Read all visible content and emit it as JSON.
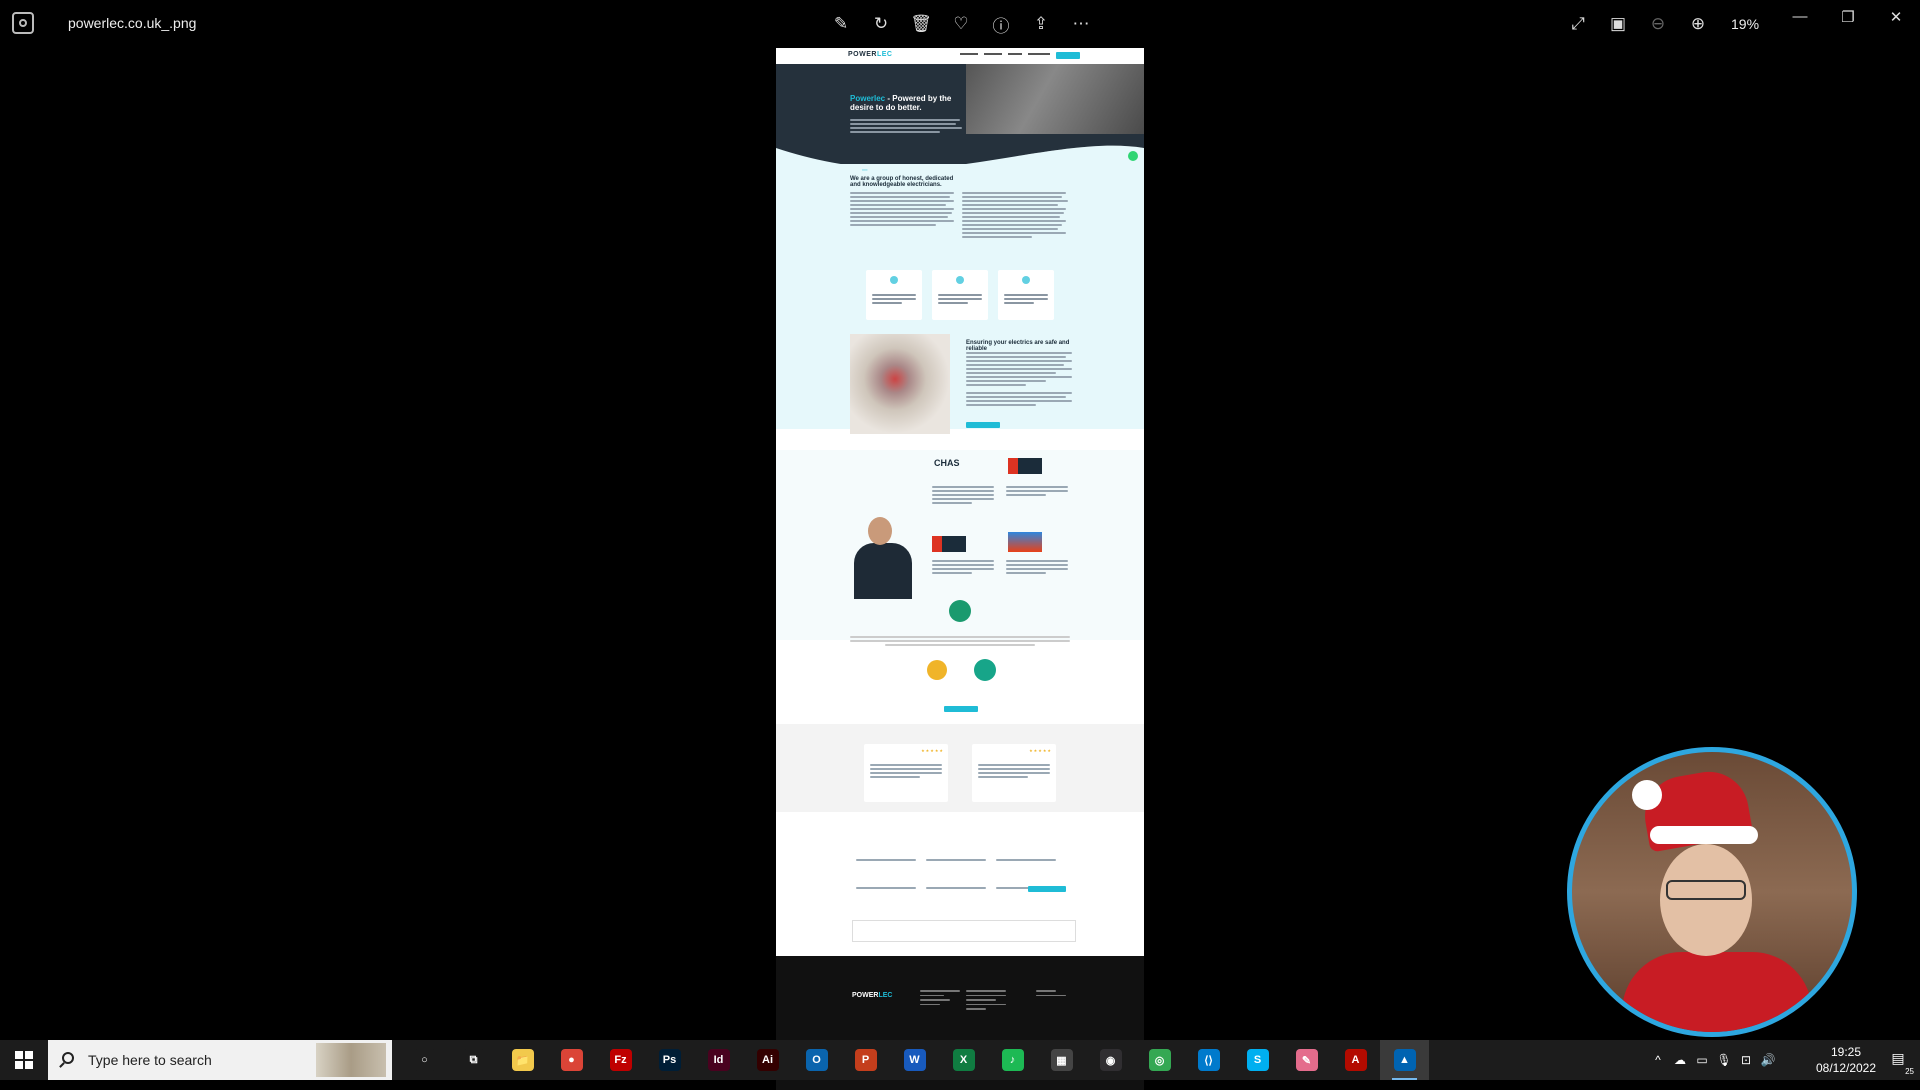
{
  "window": {
    "filename": "powerlec.co.uk_.png",
    "zoom": "19%",
    "toolbar": [
      "edit-icon",
      "rotate-icon",
      "delete-icon",
      "favorite-icon",
      "info-icon",
      "share-icon",
      "more-icon"
    ],
    "right_tools": [
      "fullscreen-icon",
      "actual-size-icon",
      "zoom-out-icon",
      "zoom-in-icon"
    ],
    "controls": {
      "minimize": "—",
      "maximize": "❐",
      "close": "✕"
    }
  },
  "webpage": {
    "logo_main": "POWER",
    "logo_accent": "LEC",
    "hero_title_accent": "Powerlec",
    "hero_title_rest": " - Powered by the desire to do better.",
    "about_title": "We are a group of honest, dedicated and knowledgeable electricians.",
    "services_title": "Ensuring your electrics are safe and reliable",
    "accreditation": {
      "chas": "CHAS"
    },
    "footer_logo_main": "POWER",
    "footer_logo_accent": "LEC"
  },
  "taskbar": {
    "search_placeholder": "Type here to search",
    "time": "19:25",
    "date": "08/12/2022",
    "notification_count": "25",
    "apps": [
      {
        "name": "cortana",
        "label": "○",
        "color": "#1c1c1c"
      },
      {
        "name": "task-view",
        "label": "⧉",
        "color": "#1c1c1c"
      },
      {
        "name": "file-explorer",
        "label": "📁",
        "color": "#f2c94c"
      },
      {
        "name": "chrome-profile",
        "label": "●",
        "color": "#db4437"
      },
      {
        "name": "filezilla",
        "label": "Fz",
        "color": "#bf0000"
      },
      {
        "name": "photoshop",
        "label": "Ps",
        "color": "#001e36"
      },
      {
        "name": "indesign",
        "label": "Id",
        "color": "#49021f"
      },
      {
        "name": "illustrator",
        "label": "Ai",
        "color": "#330000"
      },
      {
        "name": "outlook",
        "label": "O",
        "color": "#0a64ad"
      },
      {
        "name": "powerpoint",
        "label": "P",
        "color": "#c43e1c"
      },
      {
        "name": "word",
        "label": "W",
        "color": "#185abd"
      },
      {
        "name": "excel",
        "label": "X",
        "color": "#107c41"
      },
      {
        "name": "spotify",
        "label": "♪",
        "color": "#1db954"
      },
      {
        "name": "calculator",
        "label": "▦",
        "color": "#444"
      },
      {
        "name": "obs",
        "label": "◉",
        "color": "#302e31"
      },
      {
        "name": "chrome",
        "label": "◎",
        "color": "#34a853"
      },
      {
        "name": "vscode",
        "label": "⟨⟩",
        "color": "#007acc"
      },
      {
        "name": "skype",
        "label": "S",
        "color": "#00aff0"
      },
      {
        "name": "paint-app",
        "label": "✎",
        "color": "#e46c8c"
      },
      {
        "name": "acrobat",
        "label": "A",
        "color": "#b30b00"
      },
      {
        "name": "photos",
        "label": "▲",
        "color": "#0063b1"
      }
    ]
  }
}
